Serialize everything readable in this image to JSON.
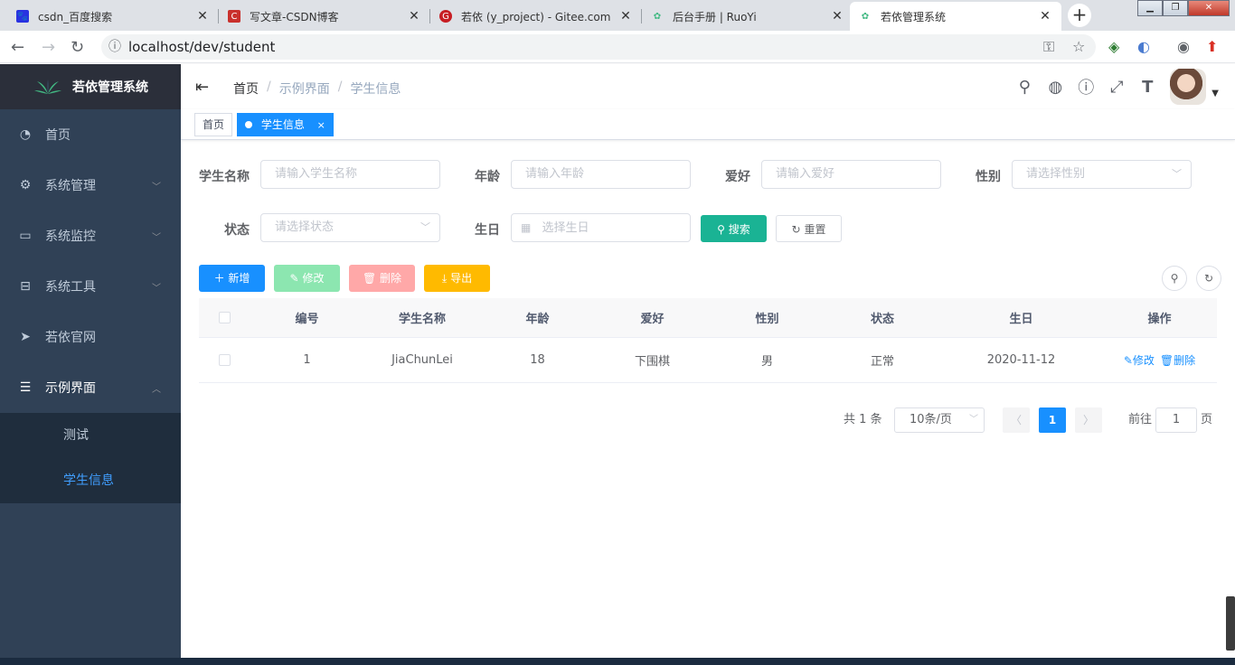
{
  "browser": {
    "tabs": [
      {
        "title": "csdn_百度搜索",
        "favicon": "baidu-icon",
        "color": "#2932e1"
      },
      {
        "title": "写文章-CSDN博客",
        "favicon": "csdn-icon",
        "color": "#c9302c"
      },
      {
        "title": "若依 (y_project) - Gitee.com",
        "favicon": "gitee-icon",
        "color": "#c71d23"
      },
      {
        "title": "后台手册 | RuoYi",
        "favicon": "ruoyi-icon",
        "color": "#42b983"
      },
      {
        "title": "若依管理系统",
        "favicon": "ruoyi-icon",
        "color": "#42b983"
      }
    ],
    "url": "localhost/dev/student"
  },
  "sidebar": {
    "logo_title": "若依管理系统",
    "items": [
      {
        "label": "首页",
        "icon": "dashboard-icon"
      },
      {
        "label": "系统管理",
        "icon": "gear-icon"
      },
      {
        "label": "系统监控",
        "icon": "monitor-icon"
      },
      {
        "label": "系统工具",
        "icon": "toolbox-icon"
      },
      {
        "label": "若依官网",
        "icon": "send-icon"
      },
      {
        "label": "示例界面",
        "icon": "list-icon"
      }
    ],
    "subitems": [
      {
        "label": "测试"
      },
      {
        "label": "学生信息"
      }
    ]
  },
  "breadcrumb": [
    "首页",
    "示例界面",
    "学生信息"
  ],
  "tags": [
    {
      "label": "首页"
    },
    {
      "label": "学生信息"
    }
  ],
  "form": {
    "name_label": "学生名称",
    "name_placeholder": "请输入学生名称",
    "age_label": "年龄",
    "age_placeholder": "请输入年龄",
    "hobby_label": "爱好",
    "hobby_placeholder": "请输入爱好",
    "gender_label": "性别",
    "gender_placeholder": "请选择性别",
    "status_label": "状态",
    "status_placeholder": "请选择状态",
    "birthday_label": "生日",
    "birthday_placeholder": "选择生日",
    "search_label": "搜索",
    "reset_label": "重置"
  },
  "toolbar": {
    "add_label": "新增",
    "edit_label": "修改",
    "delete_label": "删除",
    "export_label": "导出"
  },
  "table": {
    "headers": [
      "编号",
      "学生名称",
      "年龄",
      "爱好",
      "性别",
      "状态",
      "生日",
      "操作"
    ],
    "rows": [
      {
        "id": "1",
        "name": "JiaChunLei",
        "age": "18",
        "hobby": "下围棋",
        "gender": "男",
        "status": "正常",
        "birthday": "2020-11-12",
        "edit": "修改",
        "delete": "删除"
      }
    ]
  },
  "pagination": {
    "total_text": "共 1 条",
    "page_size": "10条/页",
    "current_page": "1",
    "goto_label": "前往",
    "goto_value": "1",
    "page_unit": "页"
  },
  "colors": {
    "sidebar_bg": "#304156",
    "primary": "#1890ff",
    "search_btn": "#1ab394",
    "active_menu": "#409eff"
  }
}
